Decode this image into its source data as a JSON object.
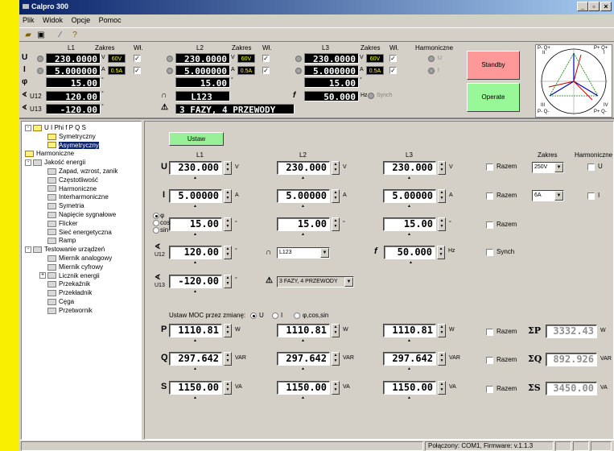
{
  "window": {
    "title": "Calpro 300",
    "min": "_",
    "max": "▫",
    "close": "×"
  },
  "menu": [
    "Plik",
    "Widok",
    "Opcje",
    "Pomoc"
  ],
  "panel": {
    "headers": {
      "l1": "L1",
      "l2": "L2",
      "l3": "L3",
      "zakres": "Zakres",
      "wl": "Wł.",
      "harm": "Harmoniczne"
    },
    "rows": {
      "u": "U",
      "i": "I",
      "phi": "φ"
    },
    "u_values": [
      "230.0000",
      "230.0000",
      "230.0000"
    ],
    "u_unit": "V",
    "u_range": "60V",
    "i_values": [
      "5.000000",
      "5.000000",
      "5.000000"
    ],
    "i_unit": "A",
    "i_range": "0.5A",
    "phi_values": [
      "15.00",
      "15.00",
      "15.00"
    ],
    "deg": "°",
    "u12_label": "U12",
    "u12": "120.00",
    "u13_label": "U13",
    "u13": "-120.00",
    "mode": "L123",
    "topology": "3 FAZY, 4 PRZEWODY",
    "f_label": "f",
    "f": "50.000",
    "f_unit": "Hz",
    "synch": "Synch",
    "harm_u": "U",
    "harm_i": "I",
    "standby": "Standby",
    "operate": "Operate",
    "phasor": {
      "q1": "P- Q+",
      "q1b": "II",
      "q2": "P+ Q+",
      "q2b": "I",
      "q3": "III",
      "q3b": "P- Q-",
      "q4": "IV",
      "q4b": "P+ Q-"
    }
  },
  "tree": [
    {
      "label": "U I Phi f P Q S",
      "depth": 0,
      "exp": "-"
    },
    {
      "label": "Symetryczny",
      "depth": 1
    },
    {
      "label": "Asymetryczny",
      "depth": 1
    },
    {
      "label": "Harmoniczne",
      "depth": 0
    },
    {
      "label": "Jakość energii",
      "depth": 0,
      "exp": "-"
    },
    {
      "label": "Zapad, wzrost, zanik",
      "depth": 1
    },
    {
      "label": "Częstotliwość",
      "depth": 1
    },
    {
      "label": "Harmoniczne",
      "depth": 1
    },
    {
      "label": "Interharmoniczne",
      "depth": 1
    },
    {
      "label": "Symetria",
      "depth": 1
    },
    {
      "label": "Napięcie sygnałowe",
      "depth": 1
    },
    {
      "label": "Flicker",
      "depth": 1
    },
    {
      "label": "Sieć energetyczna",
      "depth": 1
    },
    {
      "label": "Ramp",
      "depth": 1
    },
    {
      "label": "Testowanie urządzeń",
      "depth": 0,
      "exp": "-"
    },
    {
      "label": "Miernik analogowy",
      "depth": 1
    },
    {
      "label": "Miernik cyfrowy",
      "depth": 1
    },
    {
      "label": "Licznik energii",
      "depth": 1,
      "exp": "+"
    },
    {
      "label": "Przekaźnik",
      "depth": 1
    },
    {
      "label": "Przekładnik",
      "depth": 1
    },
    {
      "label": "Cęga",
      "depth": 1
    },
    {
      "label": "Przetwornik",
      "depth": 1
    }
  ],
  "main": {
    "ustaw": "Ustaw",
    "cols": [
      "L1",
      "L2",
      "L3"
    ],
    "zakres": "Zakres",
    "harm": "Harmoniczne",
    "u_label": "U",
    "u": [
      "230.000",
      "230.000",
      "230.000"
    ],
    "u_unit": "V",
    "i_label": "I",
    "i": [
      "5.00000",
      "5.00000",
      "5.00000"
    ],
    "i_unit": "A",
    "phi": [
      "15.00",
      "15.00",
      "15.00"
    ],
    "deg": "°",
    "phi_opts": [
      "φ",
      "cos",
      "sin"
    ],
    "razem": "Razem",
    "u_range": "250V",
    "i_range": "6A",
    "harm_u": "U",
    "harm_i": "I",
    "u12": "120.00",
    "u13": "-120.00",
    "u12_label": "U12",
    "u13_label": "U13",
    "mode": "L123",
    "topology": "3 FAZY, 4 PRZEWODY",
    "f_label": "f",
    "f": "50.000",
    "f_unit": "Hz",
    "synch": "Synch",
    "power_set": "Ustaw MOC przez zmianę:",
    "power_opts": [
      "U",
      "I",
      "φ,cos,sin"
    ],
    "p_label": "P",
    "p": [
      "1110.81",
      "1110.81",
      "1110.81"
    ],
    "p_unit": "W",
    "sp_label": "ΣP",
    "sp": "3332.43",
    "q_label": "Q",
    "q": [
      "297.642",
      "297.642",
      "297.642"
    ],
    "q_unit": "VAR",
    "sq_label": "ΣQ",
    "sq": "892.926",
    "s_label": "S",
    "s": [
      "1150.00",
      "1150.00",
      "1150.00"
    ],
    "s_unit": "VA",
    "ss_label": "ΣS",
    "ss": "3450.00"
  },
  "status": {
    "conn": "Połączony: COM1,",
    "fw": "Firmware: v.1.1.3"
  }
}
